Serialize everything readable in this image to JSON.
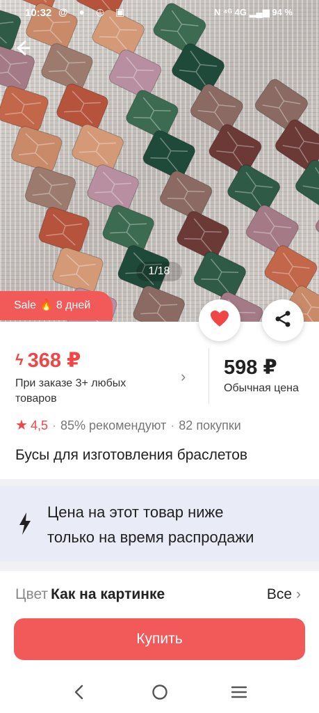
{
  "status_bar": {
    "time": "10:32",
    "left_icons": "@ ● ◷ ▣",
    "right_icons": "N  ⁴ᴳ 4G ▂▄▆ 94 %"
  },
  "gallery": {
    "counter": "1/18",
    "sale_badge": "Sale 🔥 8 дней"
  },
  "price": {
    "sale_price": "368 ₽",
    "sale_condition": "При заказе 3+ любых товаров",
    "regular_price": "598 ₽",
    "regular_label": "Обычная цена"
  },
  "rating": {
    "value": "4,5",
    "recommend": "85% рекомендуют",
    "purchases": "82 покупки"
  },
  "product": {
    "title": "Бусы для изготовления браслетов"
  },
  "promo": {
    "line1": "Цена на этот товар ниже",
    "line2": "только на время распродажи"
  },
  "color": {
    "label": "Цвет",
    "value": "Как на картинке",
    "all_label": "Все"
  },
  "buy": {
    "label": "Купить"
  },
  "colors": {
    "accent": "#f25a5a",
    "promo_bg": "#e9ecf6"
  },
  "icons": [
    "back-arrow-icon",
    "heart-icon",
    "share-icon",
    "lightning-icon",
    "star-icon",
    "chevron-right-icon",
    "nav-back-icon",
    "nav-home-icon",
    "nav-menu-icon"
  ]
}
